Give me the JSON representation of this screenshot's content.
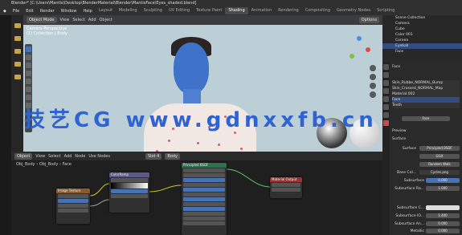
{
  "window": {
    "title": "Blender* [C:\\Users\\Mantis\\Desktop\\BlenderMaterial\\Blender\\MantisFace\\Eyes_shaded.blend]"
  },
  "menus": [
    "File",
    "Edit",
    "Render",
    "Window",
    "Help"
  ],
  "workspaces": [
    "Layout",
    "Modeling",
    "Sculpting",
    "UV Editing",
    "Texture Paint",
    "Shading",
    "Animation",
    "Rendering",
    "Compositing",
    "Geometry Nodes",
    "Scripting"
  ],
  "active_workspace": "Shading",
  "viewport": {
    "header": {
      "mode": "Object Mode",
      "view": "View",
      "select": "Select",
      "add": "Add",
      "object": "Object",
      "shading_dropdown": "Options"
    },
    "overlay": [
      "Camera Perspective",
      "(1) Collection | Body"
    ]
  },
  "watermark": "技艺CG www.gdnxxfb.cn",
  "node_editor": {
    "header": {
      "object": "Object",
      "view": "View",
      "select": "Select",
      "add": "Add",
      "node": "Node",
      "use_nodes": "Use Nodes",
      "slot": "Slot 4",
      "material": "Body"
    },
    "breadcrumb": [
      "Obj_Body",
      "Obj_Body",
      "Face"
    ],
    "nodes": [
      {
        "title": "Image Texture",
        "color": "#8a5a2a"
      },
      {
        "title": "ColorRamp",
        "color": "#5a5a8a"
      },
      {
        "title": "Principled BSDF",
        "color": "#2f6e4e"
      },
      {
        "title": "Material Output",
        "color": "#a03030"
      }
    ]
  },
  "outliner": {
    "items": [
      "Scene Collection",
      "Camera",
      "Cube",
      "Color 001",
      "Cornea",
      "Eyeball",
      "Face"
    ]
  },
  "properties": {
    "object": "Face",
    "slots": [
      "Skin_Rubbe_NORMAL_Bump",
      "Skin_Crossed_NORMAL_Map",
      "Material.002",
      "Face",
      "Teeth"
    ],
    "material_name": "Face",
    "sections": [
      "Preview",
      "Surface"
    ],
    "surface_label": "Surface",
    "surface_value": "Principled BSDF",
    "distribution": "GGX",
    "subsurface_method": "Random Walk",
    "base_color_label": "Base Col...",
    "base_color_value": "Cycles.png",
    "rows": [
      {
        "label": "Subsurface",
        "value": "0.000"
      },
      {
        "label": "Subsurface Ra...",
        "value": "1.000"
      },
      {
        "label": "Subsurface C...",
        "value": ""
      },
      {
        "label": "Subsurface IO...",
        "value": "1.400"
      },
      {
        "label": "Subsurface An...",
        "value": "0.000"
      },
      {
        "label": "Metallic",
        "value": "0.000"
      }
    ]
  },
  "colors": {
    "accent": "#4772b3",
    "header": "#303030",
    "watermark": "#2f63d1",
    "skin": "#3f72c9"
  }
}
